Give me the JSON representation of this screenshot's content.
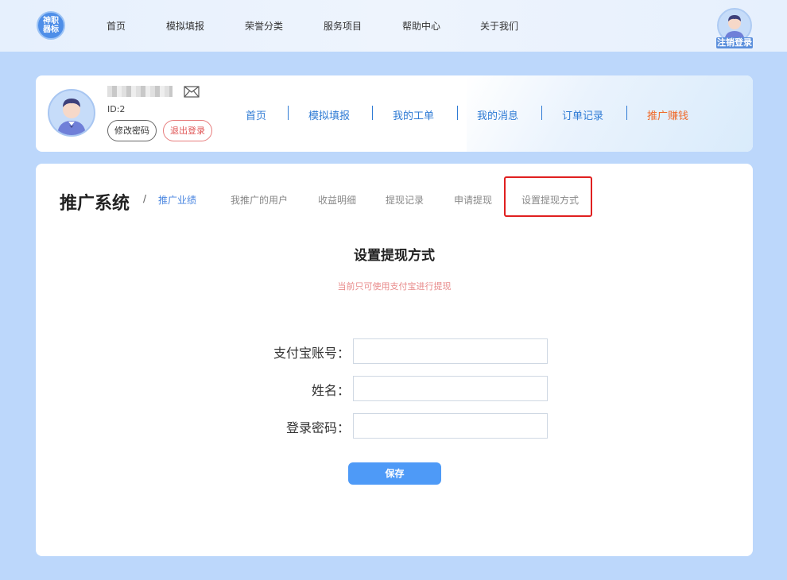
{
  "topbar": {
    "logo_text": "神职\n器标",
    "nav": [
      "首页",
      "模拟填报",
      "荣誉分类",
      "服务项目",
      "帮助中心",
      "关于我们"
    ],
    "register_label": "注销登录"
  },
  "profile": {
    "id_text": "ID:2",
    "change_password": "修改密码",
    "logout": "退出登录",
    "nav": [
      "首页",
      "模拟填报",
      "我的工单",
      "我的消息",
      "订单记录",
      "推广赚钱"
    ]
  },
  "main": {
    "system_title": "推广系统",
    "separator": "/",
    "tabs": [
      "推广业绩",
      "我推广的用户",
      "收益明细",
      "提现记录",
      "申请提现",
      "设置提现方式"
    ],
    "form_title": "设置提现方式",
    "notice": "当前只可使用支付宝进行提现",
    "fields": [
      {
        "label": "支付宝账号：",
        "value": ""
      },
      {
        "label": "姓名：",
        "value": ""
      },
      {
        "label": "登录密码：",
        "value": ""
      }
    ],
    "save_label": "保存"
  },
  "colors": {
    "accent": "#4e9af7",
    "link": "#2f7bd4",
    "active_orange": "#f06a2a",
    "highlight": "#e02020"
  }
}
